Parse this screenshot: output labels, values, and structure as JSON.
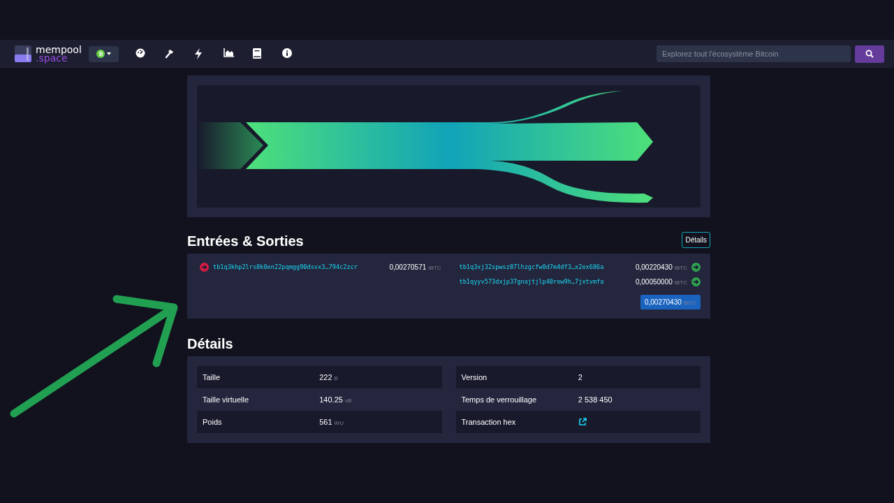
{
  "header": {
    "logo": {
      "top": "mempool",
      "bottom": ".space"
    },
    "search": {
      "placeholder": "Explorez tout l'écosystème Bitcoin"
    }
  },
  "io": {
    "title": "Entrées & Sorties",
    "details_button": "Détails",
    "inputs": [
      {
        "address": "tb1q3khp2lrs8k0en22pqmgg90dsvx3…794c2zcr",
        "amount": "0,00270571",
        "unit": "tBTC"
      }
    ],
    "outputs": [
      {
        "address": "tb1q3xj32spwsz87lhzgcfw0d7m4df3…x2ex686a",
        "amount": "0,00220430",
        "unit": "tBTC"
      },
      {
        "address": "tb1qyyv573dxjp37gnajtjlp40rew9h…7jxtvmfa",
        "amount": "0,00050000",
        "unit": "tBTC"
      }
    ],
    "total": {
      "amount": "0,00270430",
      "unit": "tBTC"
    }
  },
  "details": {
    "title": "Détails",
    "columns": [
      [
        {
          "label": "Taille",
          "value": "222",
          "unit": "B"
        },
        {
          "label": "Taille virtuelle",
          "value": "140.25",
          "unit": "vB"
        },
        {
          "label": "Poids",
          "value": "561",
          "unit": "WU"
        }
      ],
      [
        {
          "label": "Version",
          "value": "2"
        },
        {
          "label": "Temps de verrouillage",
          "value": "2 538 450"
        },
        {
          "label": "Transaction hex",
          "kind": "link"
        }
      ]
    ]
  }
}
